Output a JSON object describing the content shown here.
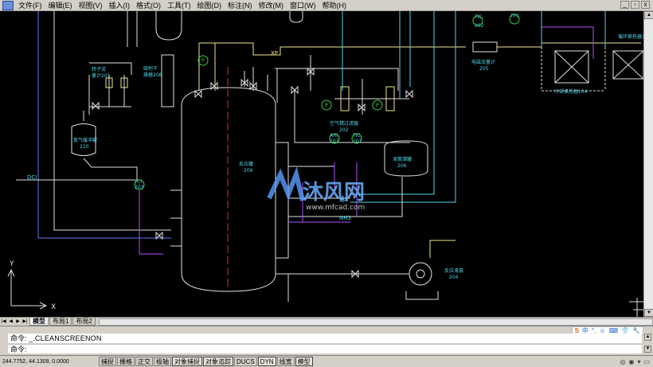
{
  "menu": {
    "items": [
      "文件(F)",
      "编辑(E)",
      "视图(V)",
      "插入(I)",
      "格式(O)",
      "工具(T)",
      "绘图(D)",
      "标注(N)",
      "修改(M)",
      "窗口(W)",
      "帮助(H)"
    ]
  },
  "window_controls": {
    "minimize": "_",
    "restore": "▫",
    "close": "x"
  },
  "drawing": {
    "labels": {
      "xp": "XP",
      "tic_top": "TIC",
      "tic_top_num": "202",
      "tfc_top": "TFC",
      "meter": "电磁流量计",
      "meter_num": "205",
      "cooler": "冷却换热器104",
      "heater": "循环换热器105",
      "flowmeter_left_a": "转子流",
      "flowmeter_left_b": "量计201",
      "flowmeter_left_c": "转子流",
      "flowmeter_left_d": "量计202",
      "dryer": "吸附干",
      "dryer_num": "燥器208",
      "gas_tank": "氮气缓冲罐",
      "gas_tank_num": "210",
      "air_filter": "空气精过滤器",
      "air_filter_num": "202",
      "reactor": "反应罐",
      "reactor_num": "209",
      "liquid_tank": "液氨储罐",
      "liquid_tank_num": "206",
      "ahi": "AHI",
      "ahi_num": "207",
      "tic_mid": "TIC",
      "tic_mid_num": "207",
      "xh": "XH",
      "nh3": "NH3",
      "dci": "DCI",
      "tic_left": "TCI",
      "tic_left_num": "203",
      "pump": "反应液泵",
      "pump_num": "204",
      "p": "P",
      "axis_x": "X",
      "axis_y": "Y",
      "watermark_brand": "沐风网",
      "watermark_url": "www.mfcad.com"
    }
  },
  "tabs": {
    "nav": [
      "|◀",
      "◀",
      "▶",
      "▶|"
    ],
    "items": [
      "模型",
      "布局1",
      "布局2"
    ],
    "active": "模型"
  },
  "command": {
    "line1_prompt": "命令:",
    "line1_text": "_.CLEANSCREENON",
    "line2_prompt": "命令:",
    "line2_text": ""
  },
  "ime": {
    "logo": "S",
    "items": [
      "中",
      "°,",
      "☺",
      "⌨",
      "👕",
      "🔧"
    ]
  },
  "status": {
    "coords": "244.7752, 44.1309, 0.0000",
    "buttons": [
      "捕捉",
      "栅格",
      "正交",
      "极轴",
      "对象捕捉",
      "对象追踪",
      "DUCS",
      "DYN",
      "线宽",
      "模型"
    ],
    "on": [
      "对象捕捉",
      "对象追踪",
      "DYN",
      "模型"
    ]
  },
  "colors": {
    "canvas": "#000000",
    "line_white": "#e0e0e0",
    "line_yellow": "#f0e68c",
    "line_cyan": "#4fd5e6",
    "line_blue": "#5a7af0",
    "line_purple": "#b050ff",
    "line_red": "#e03030",
    "instrument_green": "#40d040",
    "watermark": "#5aa0ff"
  }
}
